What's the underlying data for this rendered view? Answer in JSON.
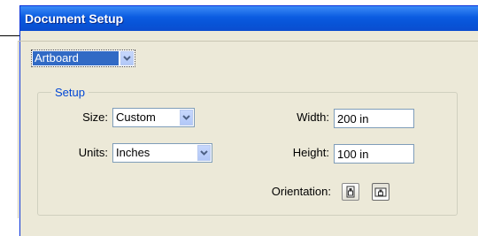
{
  "dialog": {
    "title": "Document Setup",
    "category": {
      "selected": "Artboard"
    },
    "setup_group": {
      "label": "Setup",
      "size": {
        "label": "Size:",
        "value": "Custom"
      },
      "units": {
        "label": "Units:",
        "value": "Inches"
      },
      "width": {
        "label": "Width:",
        "value": "200 in"
      },
      "height": {
        "label": "Height:",
        "value": "100 in"
      },
      "orientation": {
        "label": "Orientation:",
        "options": [
          "portrait",
          "landscape"
        ],
        "selected": "landscape"
      }
    }
  },
  "colors": {
    "title_bar": "#0A5BE0",
    "dialog_bg": "#ECE9D8",
    "group_label": "#0046D5",
    "selection": "#316AC5"
  }
}
